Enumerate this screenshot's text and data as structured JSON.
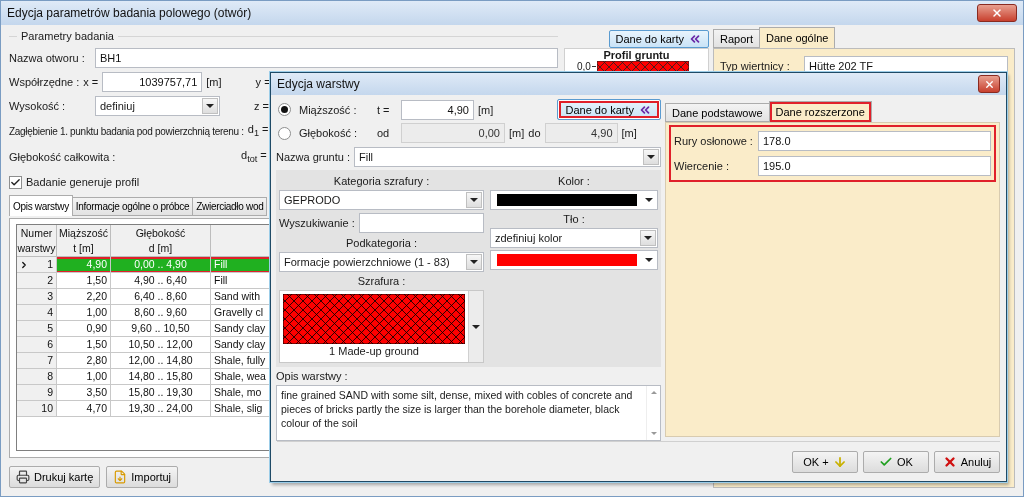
{
  "window": {
    "title": "Edycja parametrów badania polowego (otwór)"
  },
  "params": {
    "legend": "Parametry badania",
    "name": {
      "label": "Nazwa otworu :",
      "value": "BH1"
    },
    "coords": {
      "label": "Współrzędne :",
      "x_label": "x =",
      "x_value": "1039757,71",
      "x_unit": "[m]",
      "y_label": "y ="
    },
    "height": {
      "label": "Wysokość :",
      "value": "definiuj",
      "z_label": "z ="
    },
    "depth1": {
      "label": "Zagłębienie 1. punktu badania pod powierzchnią terenu :",
      "symbol": "d$_{1}$ ="
    },
    "total_depth": {
      "label": "Głębokość całkowita :",
      "symbol": "d$_{tot}$ ="
    },
    "generate_profile": {
      "label": "Badanie generuje profil",
      "checked": true
    }
  },
  "tabs": [
    {
      "label": "Opis warstwy",
      "selected": true
    },
    {
      "label": "Informacje ogólne o próbce",
      "selected": false
    },
    {
      "label": "Zwierciadło wod",
      "selected": false
    }
  ],
  "table": {
    "columns": [
      "Numer\nwarstwy",
      "Miąższość\nt [m]",
      "Głębokość\nd [m]"
    ],
    "rows": [
      {
        "cells": [
          "1",
          "4,90",
          "0,00 .. 4,90",
          "Fill"
        ],
        "selected": true,
        "highlighted": true
      },
      {
        "cells": [
          "2",
          "1,50",
          "4,90 .. 6,40",
          "Fill"
        ],
        "selected": false,
        "highlighted": false
      },
      {
        "cells": [
          "3",
          "2,20",
          "6,40 .. 8,60",
          "Sand with"
        ],
        "selected": false,
        "highlighted": false
      },
      {
        "cells": [
          "4",
          "1,00",
          "8,60 .. 9,60",
          "Gravelly cl"
        ],
        "selected": false,
        "highlighted": false
      },
      {
        "cells": [
          "5",
          "0,90",
          "9,60 .. 10,50",
          "Sandy clay"
        ],
        "selected": false,
        "highlighted": false
      },
      {
        "cells": [
          "6",
          "1,50",
          "10,50 .. 12,00",
          "Sandy clay"
        ],
        "selected": false,
        "highlighted": false
      },
      {
        "cells": [
          "7",
          "2,80",
          "12,00 .. 14,80",
          "Shale, fully"
        ],
        "selected": false,
        "highlighted": false
      },
      {
        "cells": [
          "8",
          "1,00",
          "14,80 .. 15,80",
          "Shale, wea"
        ],
        "selected": false,
        "highlighted": false
      },
      {
        "cells": [
          "9",
          "3,50",
          "15,80 .. 19,30",
          "Shale, mo"
        ],
        "selected": false,
        "highlighted": false
      },
      {
        "cells": [
          "10",
          "4,70",
          "19,30 .. 24,00",
          "Shale, slig"
        ],
        "selected": false,
        "highlighted": false
      }
    ]
  },
  "bottom_buttons": [
    {
      "label": "Drukuj kartę",
      "kind": "print"
    },
    {
      "label": "Importuj",
      "kind": "import"
    }
  ],
  "card_button": {
    "label": "Dane do karty"
  },
  "profile": {
    "title": "Profil gruntu",
    "tick": "0,0"
  },
  "side_tabs": [
    {
      "label": "Raport",
      "selected": false
    },
    {
      "label": "Dane ogólne",
      "selected": true
    }
  ],
  "rig": {
    "label": "Typ wiertnicy :",
    "value": "Hütte 202 TF"
  },
  "dialog": {
    "title": "Edycja warstwy",
    "thickness": {
      "label": "Miąższość :",
      "selected": true,
      "symbol": "t =",
      "value": "4,90",
      "unit": "[m]"
    },
    "depth": {
      "label": "Głębokość :",
      "selected": false,
      "disabled": true,
      "from_label": "od",
      "from": "0,00",
      "from_unit": "[m]",
      "to_label": "do",
      "to": "4,90",
      "to_unit": "[m]"
    },
    "card_button": {
      "label": "Dane do karty",
      "highlighted": true
    },
    "soil_name": {
      "label": "Nazwa gruntu :",
      "value": "Fill"
    },
    "hatch": {
      "category_label": "Kategoria szrafury :",
      "category": "GEPRODO",
      "search_label": "Wyszukiwanie :",
      "subcategory_label": "Podkategoria :",
      "subcategory": "Formacje powierzchniowe (1 - 83)",
      "pattern_label": "Szrafura :",
      "pattern": "1 Made-up ground"
    },
    "line_color": {
      "label": "Kolor :",
      "color": "#000000"
    },
    "background": {
      "label": "Tło :",
      "mode": "zdefiniuj kolor",
      "color": "#ff0000"
    },
    "description": {
      "label": "Opis warstwy :",
      "text": "fine grained SAND with some silt, dense, mixed with cobles of concrete and pieces of bricks partly the size is larger than the borehole diameter, black colour of the soil"
    },
    "tabs": [
      {
        "label": "Dane podstawowe",
        "selected": false,
        "highlighted": false
      },
      {
        "label": "Dane rozszerzone",
        "selected": true,
        "highlighted": true
      }
    ],
    "extended": {
      "highlighted": true,
      "fields": [
        {
          "label": "Rury osłonowe :",
          "value": "178.0"
        },
        {
          "label": "Wiercenie :",
          "value": "195.0"
        }
      ]
    },
    "buttons": [
      {
        "label": "OK +",
        "kind": "next"
      },
      {
        "label": "OK",
        "kind": "ok"
      },
      {
        "label": "Anuluj",
        "kind": "cancel"
      }
    ]
  }
}
